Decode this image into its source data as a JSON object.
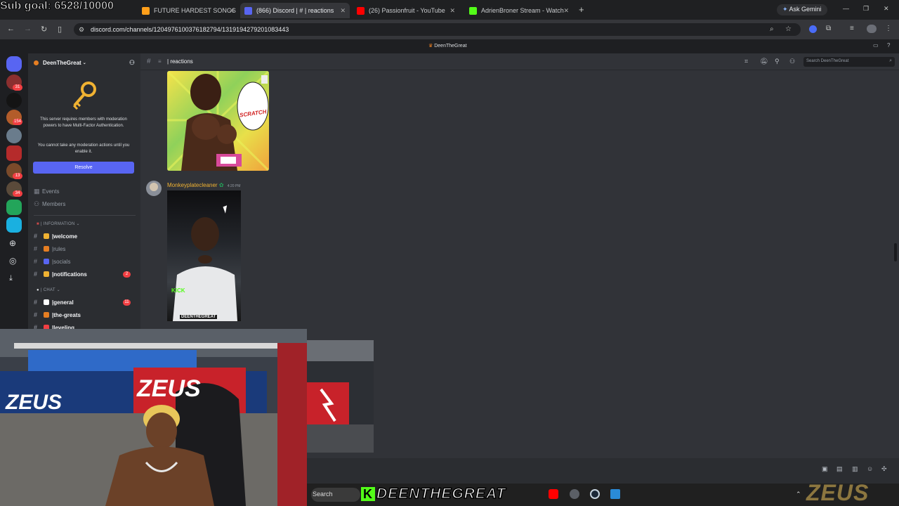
{
  "overlay": {
    "subgoal": "Sub goal: 6528/10000",
    "brand": "DEENTHEGREAT",
    "brand_letter": "K",
    "watermark": "ZEUS"
  },
  "browser": {
    "tabs": [
      {
        "label": "FUTURE HARDEST SONGS",
        "color": "#ff9f1a"
      },
      {
        "label": "(866) Discord | # | reactions",
        "color": "#5865f2"
      },
      {
        "label": "(26) Passionfruit - YouTube",
        "color": "#ff0000"
      },
      {
        "label": "AdrienBroner Stream - Watch",
        "color": "#53fc18"
      }
    ],
    "new_tab": "+",
    "ask_gemini": "Ask Gemini",
    "url": "discord.com/channels/1204976100376182794/1319194279201083443",
    "nav_icons": [
      "back-icon",
      "forward-icon",
      "reload-icon",
      "sidebar-icon",
      "site-info-icon"
    ],
    "window_controls": [
      "—",
      "❐",
      "✕"
    ]
  },
  "discord": {
    "window_title": "DeenTheGreat",
    "server_name": "DeenTheGreat",
    "mfa_notice": "This server requires members with moderation powers to have Multi-Factor Authentication.",
    "mfa_sub": "You cannot take any moderation actions until you enable it.",
    "resolve_label": "Resolve",
    "nav": [
      {
        "label": "Events"
      },
      {
        "label": "Members"
      }
    ],
    "categories": [
      "INFORMATION",
      "CHAT"
    ],
    "channels": [
      {
        "name": "welcome",
        "unread": true,
        "badge": "",
        "emoji_color": "#f0b232"
      },
      {
        "name": "rules",
        "unread": false,
        "badge": "",
        "emoji_color": "#e67e22"
      },
      {
        "name": "socials",
        "unread": false,
        "badge": "",
        "emoji_color": "#5865f2"
      },
      {
        "name": "notifications",
        "unread": true,
        "badge": "2",
        "emoji_color": "#f0b232"
      },
      {
        "name": "general",
        "unread": true,
        "badge": "11",
        "emoji_color": "#ffffff"
      },
      {
        "name": "the-greats",
        "unread": true,
        "badge": "",
        "emoji_color": "#e67e22"
      },
      {
        "name": "leveling",
        "unread": true,
        "badge": "",
        "emoji_color": "#f23f43"
      }
    ],
    "guild_badges": [
      "31",
      "154",
      "13",
      "34"
    ],
    "channel_header": "reactions",
    "search_placeholder": "Search DeenTheGreat",
    "message": {
      "author": "Monkeyplatecleaner",
      "time": "4:20 PM"
    },
    "video_overlay": {
      "kick": "KICK",
      "tag": "DEENTHEGREAT"
    },
    "comic_text": "SCRATCH"
  },
  "taskbar": {
    "search_label": "Search"
  }
}
